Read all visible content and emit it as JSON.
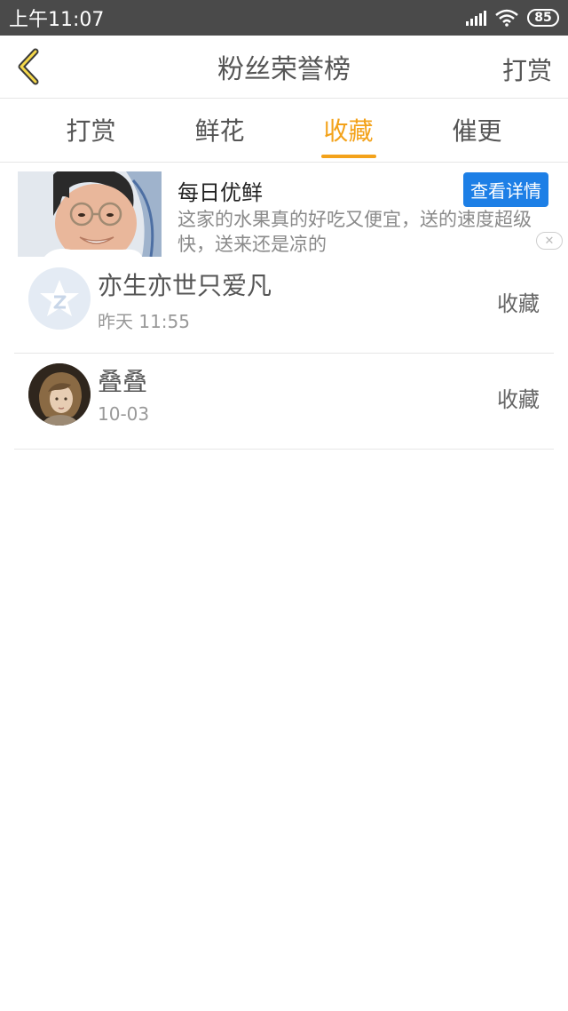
{
  "status_bar": {
    "time": "上午11:07",
    "battery": "85",
    "icons": [
      "signal-icon",
      "wifi-icon",
      "battery-icon"
    ]
  },
  "header": {
    "title": "粉丝荣誉榜",
    "right_link": "打赏",
    "back_icon": "chevron-left-icon"
  },
  "tabs": [
    {
      "label": "打赏",
      "active": false
    },
    {
      "label": "鲜花",
      "active": false
    },
    {
      "label": "收藏",
      "active": true
    },
    {
      "label": "催更",
      "active": false
    }
  ],
  "ad": {
    "title": "每日优鲜",
    "button": "查看详情",
    "description": "这家的水果真的好吃又便宜，送的速度超级快，送来还是凉的",
    "close_icon": "close-icon"
  },
  "list": [
    {
      "name": "亦生亦世只爱凡",
      "time": "昨天 11:55",
      "action": "收藏",
      "avatar": "default-avatar-icon"
    },
    {
      "name": "叠叠",
      "time": "10-03",
      "action": "收藏",
      "avatar": "user-avatar"
    }
  ],
  "colors": {
    "accent": "#f3a21a",
    "ad_button": "#1d7fe6",
    "status_bar": "#4a4a4a"
  }
}
